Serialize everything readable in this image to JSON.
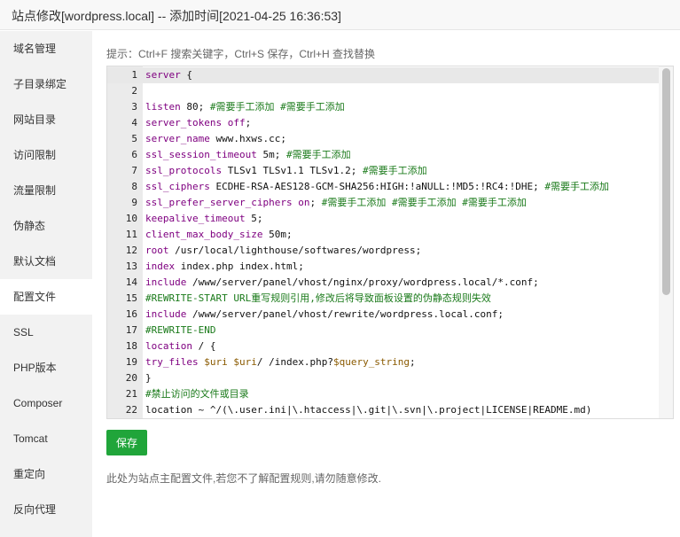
{
  "dialog": {
    "title": "站点修改[wordpress.local] -- 添加时间[2021-04-25 16:36:53]"
  },
  "sidebar": {
    "items": [
      {
        "label": "域名管理"
      },
      {
        "label": "子目录绑定"
      },
      {
        "label": "网站目录"
      },
      {
        "label": "访问限制"
      },
      {
        "label": "流量限制"
      },
      {
        "label": "伪静态"
      },
      {
        "label": "默认文档"
      },
      {
        "label": "配置文件"
      },
      {
        "label": "SSL"
      },
      {
        "label": "PHP版本"
      },
      {
        "label": "Composer"
      },
      {
        "label": "Tomcat"
      },
      {
        "label": "重定向"
      },
      {
        "label": "反向代理"
      }
    ],
    "active_index": 7
  },
  "tip": "提示：Ctrl+F 搜索关键字，Ctrl+S 保存，Ctrl+H 查找替换",
  "editor": {
    "lines": [
      {
        "n": "1",
        "parts": [
          {
            "t": "server",
            "c": "k"
          },
          {
            "t": " {"
          }
        ]
      },
      {
        "n": "2",
        "parts": []
      },
      {
        "n": "3",
        "parts": [
          {
            "t": "listen",
            "c": "k"
          },
          {
            "t": " 80; "
          },
          {
            "t": "#需要手工添加 #需要手工添加",
            "c": "c"
          }
        ]
      },
      {
        "n": "4",
        "parts": [
          {
            "t": "server_tokens",
            "c": "k"
          },
          {
            "t": " "
          },
          {
            "t": "off",
            "c": "k"
          },
          {
            "t": ";"
          }
        ]
      },
      {
        "n": "5",
        "parts": [
          {
            "t": "server_name",
            "c": "k"
          },
          {
            "t": " www.hxws.cc;"
          }
        ]
      },
      {
        "n": "6",
        "parts": [
          {
            "t": "ssl_session_timeout",
            "c": "k"
          },
          {
            "t": " 5m; "
          },
          {
            "t": "#需要手工添加",
            "c": "c"
          }
        ]
      },
      {
        "n": "7",
        "parts": [
          {
            "t": "ssl_protocols",
            "c": "k"
          },
          {
            "t": " TLSv1 TLSv1.1 TLSv1.2; "
          },
          {
            "t": "#需要手工添加",
            "c": "c"
          }
        ]
      },
      {
        "n": "8",
        "parts": [
          {
            "t": "ssl_ciphers",
            "c": "k"
          },
          {
            "t": " ECDHE-RSA-AES128-GCM-SHA256:HIGH:!aNULL:!MD5:!RC4:!DHE; "
          },
          {
            "t": "#需要手工添加",
            "c": "c"
          }
        ]
      },
      {
        "n": "9",
        "parts": [
          {
            "t": "ssl_prefer_server_ciphers",
            "c": "k"
          },
          {
            "t": " "
          },
          {
            "t": "on",
            "c": "k"
          },
          {
            "t": "; "
          },
          {
            "t": "#需要手工添加 #需要手工添加 #需要手工添加",
            "c": "c"
          }
        ]
      },
      {
        "n": "10",
        "parts": [
          {
            "t": "keepalive_timeout",
            "c": "k"
          },
          {
            "t": " 5;"
          }
        ]
      },
      {
        "n": "11",
        "parts": [
          {
            "t": "client_max_body_size",
            "c": "k"
          },
          {
            "t": " 50m;"
          }
        ]
      },
      {
        "n": "12",
        "parts": [
          {
            "t": "root",
            "c": "k"
          },
          {
            "t": " /usr/local/lighthouse/softwares/wordpress;"
          }
        ]
      },
      {
        "n": "13",
        "parts": [
          {
            "t": "index",
            "c": "k"
          },
          {
            "t": " index.php index.html;"
          }
        ]
      },
      {
        "n": "14",
        "parts": [
          {
            "t": "include",
            "c": "k"
          },
          {
            "t": " /www/server/panel/vhost/nginx/proxy/wordpress.local/*.conf;"
          }
        ]
      },
      {
        "n": "15",
        "parts": [
          {
            "t": "#REWRITE-START URL重写规则引用,修改后将导致面板设置的伪静态规则失效",
            "c": "c"
          }
        ]
      },
      {
        "n": "16",
        "parts": [
          {
            "t": "include",
            "c": "k"
          },
          {
            "t": " /www/server/panel/vhost/rewrite/wordpress.local.conf;"
          }
        ]
      },
      {
        "n": "17",
        "parts": [
          {
            "t": "#REWRITE-END",
            "c": "c"
          }
        ]
      },
      {
        "n": "18",
        "parts": [
          {
            "t": "location",
            "c": "k"
          },
          {
            "t": " / {"
          }
        ]
      },
      {
        "n": "19",
        "parts": [
          {
            "t": "try_files",
            "c": "k"
          },
          {
            "t": " "
          },
          {
            "t": "$uri",
            "c": "v"
          },
          {
            "t": " "
          },
          {
            "t": "$uri",
            "c": "v"
          },
          {
            "t": "/ /index.php?"
          },
          {
            "t": "$query_string",
            "c": "v"
          },
          {
            "t": ";"
          }
        ]
      },
      {
        "n": "20",
        "parts": [
          {
            "t": "}"
          }
        ]
      },
      {
        "n": "21",
        "parts": [
          {
            "t": "#禁止访问的文件或目录",
            "c": "c"
          }
        ]
      },
      {
        "n": "22",
        "parts": [
          {
            "t": "location ~ ^/(\\.user.ini|\\.htaccess|\\.git|\\.svn|\\.project|LICENSE|README.md)"
          }
        ]
      }
    ]
  },
  "save_button": "保存",
  "note": "此处为站点主配置文件,若您不了解配置规则,请勿随意修改."
}
